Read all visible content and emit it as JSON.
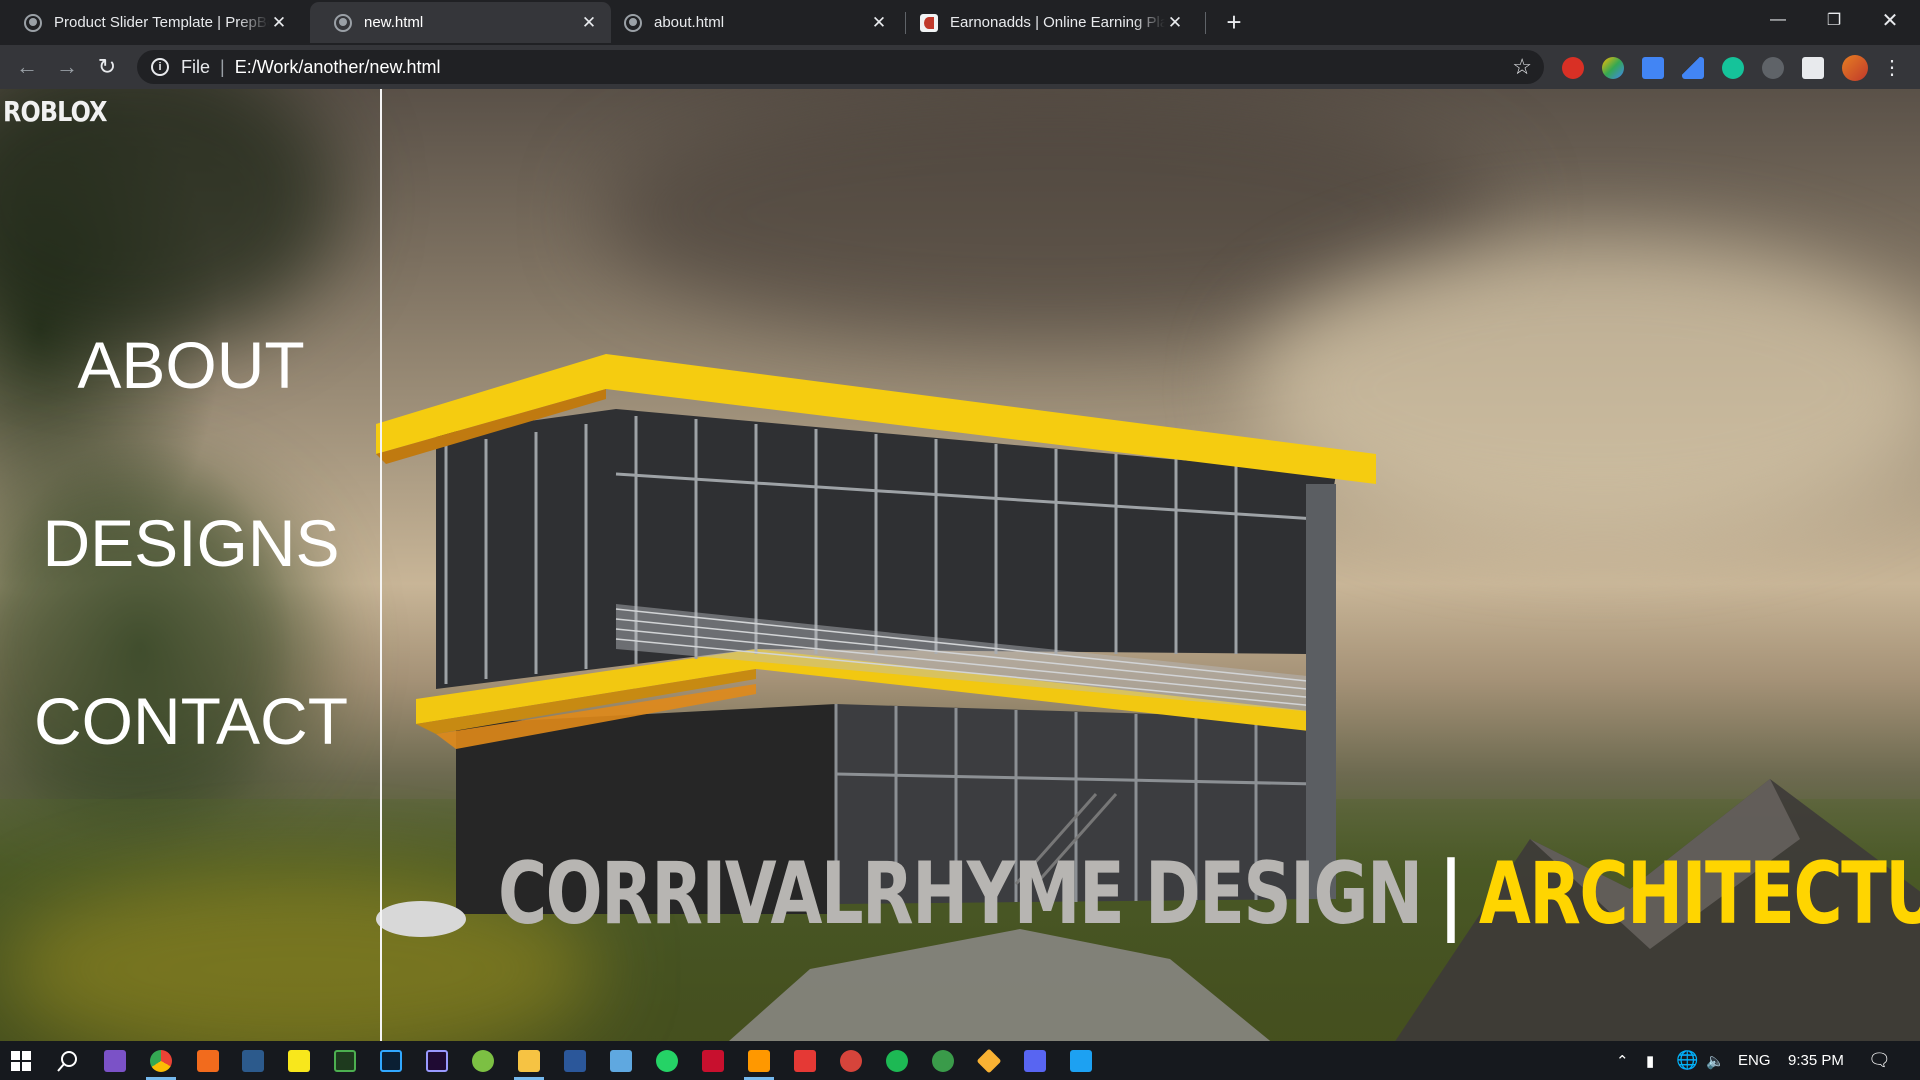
{
  "browser": {
    "tabs": [
      {
        "title": "Product Slider Template | PrepBootstrap",
        "active": false
      },
      {
        "title": "new.html",
        "active": true
      },
      {
        "title": "about.html",
        "active": false
      },
      {
        "title": "Earnonadds | Online Earning Platform",
        "active": false
      }
    ],
    "address": {
      "scheme": "File",
      "url": "E:/Work/another/new.html"
    }
  },
  "page": {
    "logo": "ROBLOX",
    "nav": [
      {
        "label": "ABOUT"
      },
      {
        "label": "DESIGNS"
      },
      {
        "label": "CONTACT"
      }
    ],
    "headline": {
      "part1": "CORRIVALRHYME DESIGN",
      "separator": "|",
      "part2": "ARCHITECTURE"
    }
  },
  "taskbar": {
    "language": "ENG",
    "time": "9:35 PM"
  },
  "colors": {
    "accent_yellow": "#ffd500",
    "headline_grey": "#b7b5b2",
    "chrome_dark": "#202124",
    "chrome_toolbar": "#35363a"
  }
}
